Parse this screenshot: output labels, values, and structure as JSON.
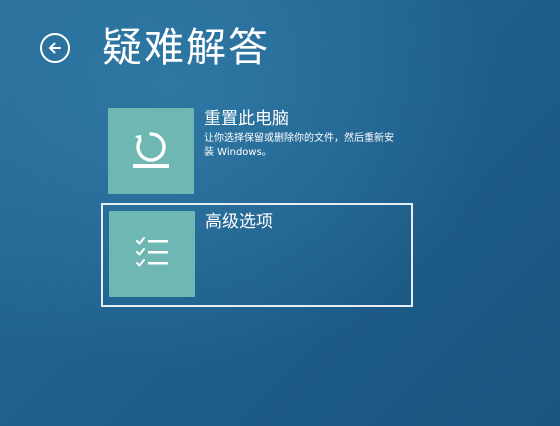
{
  "header": {
    "back_icon": "back-arrow-circle-icon",
    "title": "疑难解答"
  },
  "options": [
    {
      "icon": "reset-pc-icon",
      "title": "重置此电脑",
      "description": "让你选择保留或删除你的文件，然后重新安装 Windows。"
    },
    {
      "icon": "checklist-icon",
      "title": "高级选项",
      "description": ""
    }
  ],
  "colors": {
    "background": "#1f5f8d",
    "tile": "#6fb7b3",
    "text": "#ffffff",
    "focus_border": "#e6eef4"
  }
}
